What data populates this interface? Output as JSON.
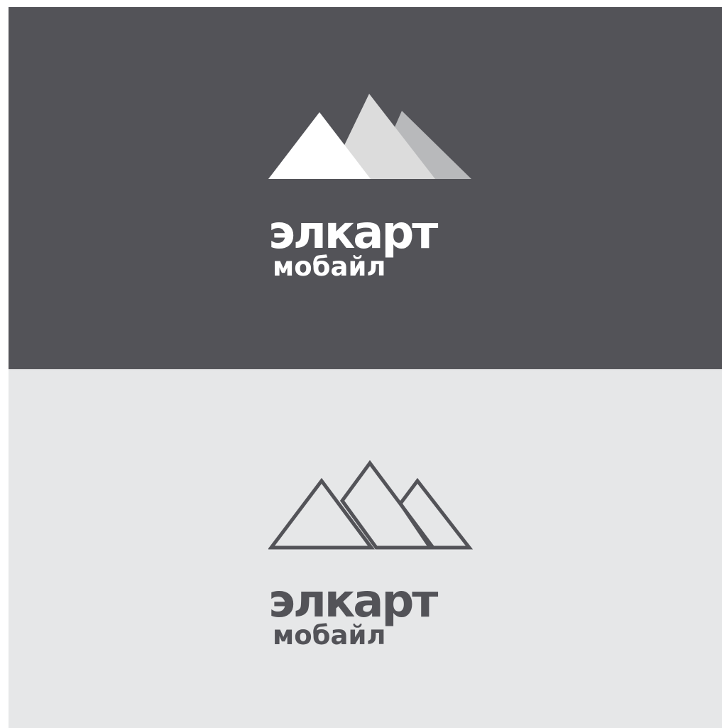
{
  "variants": [
    {
      "background": "#535358",
      "style": "filled",
      "brand_main": "элкарт",
      "brand_sub": "мобайл",
      "text_color": "#ffffff",
      "mountain_colors": [
        "#ffffff",
        "#dcdcdc",
        "#b8b9bb"
      ]
    },
    {
      "background": "#e6e7e8",
      "style": "outline",
      "brand_main": "элкарт",
      "brand_sub": "мобайл",
      "text_color": "#535358",
      "mountain_colors": [
        "#535358",
        "#535358",
        "#535358"
      ]
    }
  ]
}
